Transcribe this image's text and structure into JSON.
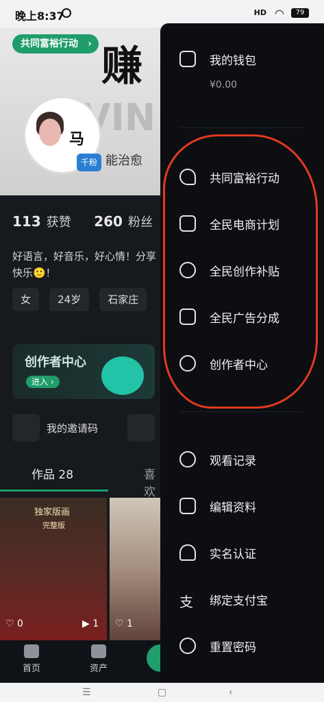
{
  "status": {
    "time": "晚上8:37",
    "signal": "HD",
    "battery": "79"
  },
  "profile": {
    "cover_button": "共同富裕行动",
    "cover_big_text": "赚",
    "cover_faint": "VIN",
    "avatar_text": "马",
    "avatar_badge": "千粉",
    "cover_subtitle": "能治愈",
    "likes_count": "113",
    "likes_label": "获赞",
    "fans_count": "260",
    "fans_label": "粉丝",
    "bio": "好语言，好音乐，好心情！分享快乐🙂！",
    "tags": [
      "女",
      "24岁",
      "石家庄"
    ],
    "creator_center": "创作者中心",
    "creator_enter": "进入",
    "invite_code": "我的邀请码",
    "tab_works": "作品 28",
    "tab_likes": "喜欢",
    "thumb1_title": "独家版画",
    "thumb1_subtitle": "完整版",
    "thumb1_likes": "0",
    "thumb1_plays": "1",
    "thumb2_likes": "1",
    "bottom_nav": {
      "home": "首页",
      "assets": "资产"
    }
  },
  "drawer": {
    "wallet_label": "我的钱包",
    "wallet_balance": "¥0.00",
    "items": [
      "共同富裕行动",
      "全民电商计划",
      "全民创作补贴",
      "全民广告分成",
      "创作者中心",
      "观看记录",
      "编辑资料",
      "实名认证",
      "绑定支付宝",
      "重置密码"
    ]
  },
  "colors": {
    "accent": "#1f9d6a",
    "annotation": "#e23a22"
  }
}
